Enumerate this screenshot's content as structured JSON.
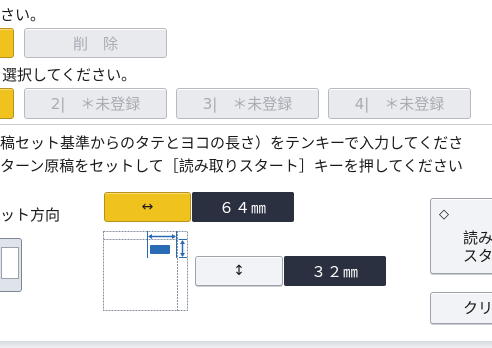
{
  "row1": {
    "text_fragment": "さい。",
    "delete_button": "削　除"
  },
  "row2": {
    "text_fragment": "選択してください。",
    "register_buttons": [
      "2|　＊未登録",
      "3|　＊未登録",
      "4|　＊未登録"
    ]
  },
  "instructions": {
    "line1": "稿セット基準からのタテとヨコの長さ）をテンキーで入力してくださ",
    "line2": "ターン原稿をセットして［読み取りスタート］キーを押してください"
  },
  "set_direction_label": "ット方向",
  "horizontal": {
    "arrow": "↔",
    "value": "６４㎜"
  },
  "vertical": {
    "arrow": "↕",
    "value": "３２㎜"
  },
  "right_panel": {
    "start_line1": "読み",
    "start_line2": "スタ",
    "clear_label": "クリ"
  },
  "colors": {
    "yellow": "#f0c21e",
    "dark": "#2b3040",
    "blue": "#2a6bb6"
  }
}
